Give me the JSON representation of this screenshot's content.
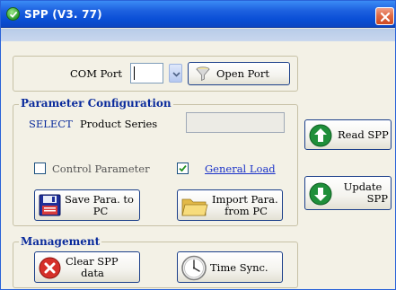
{
  "window": {
    "title": "SPP (V3. 77)"
  },
  "com": {
    "label": "COM Port",
    "port_value": "",
    "open_button": "Open Port"
  },
  "param": {
    "title": "Parameter Configuration",
    "select_label": "SELECT",
    "product_label": "Product Series",
    "product_value": "",
    "control_label": "Control Parameter",
    "control_checked": false,
    "general_label": "General Load",
    "general_checked": true,
    "save_button": [
      "Save Para. to",
      "PC"
    ],
    "import_button": [
      "Import Para.",
      "from PC"
    ]
  },
  "side": {
    "read_button": "Read SPP",
    "update_button": [
      "Update",
      "SPP"
    ]
  },
  "management": {
    "title": "Management",
    "clear_button": [
      "Clear SPP",
      "data"
    ],
    "timesync_button": "Time Sync."
  },
  "colors": {
    "titlebar": "#0a4fd6",
    "group_title": "#0a2b9c",
    "select_text": "#0a2b9c",
    "link": "#1a32c8",
    "close": "#e06b45",
    "green_arrow": "#1f8f3a",
    "clear_red": "#d5302a"
  },
  "icons": [
    "check-title-icon",
    "close-icon",
    "chevron-down-icon",
    "funnel-icon",
    "checkmark-icon",
    "floppy-disk-icon",
    "folder-icon",
    "arrow-up-icon",
    "arrow-down-icon",
    "red-x-icon",
    "clock-icon"
  ]
}
